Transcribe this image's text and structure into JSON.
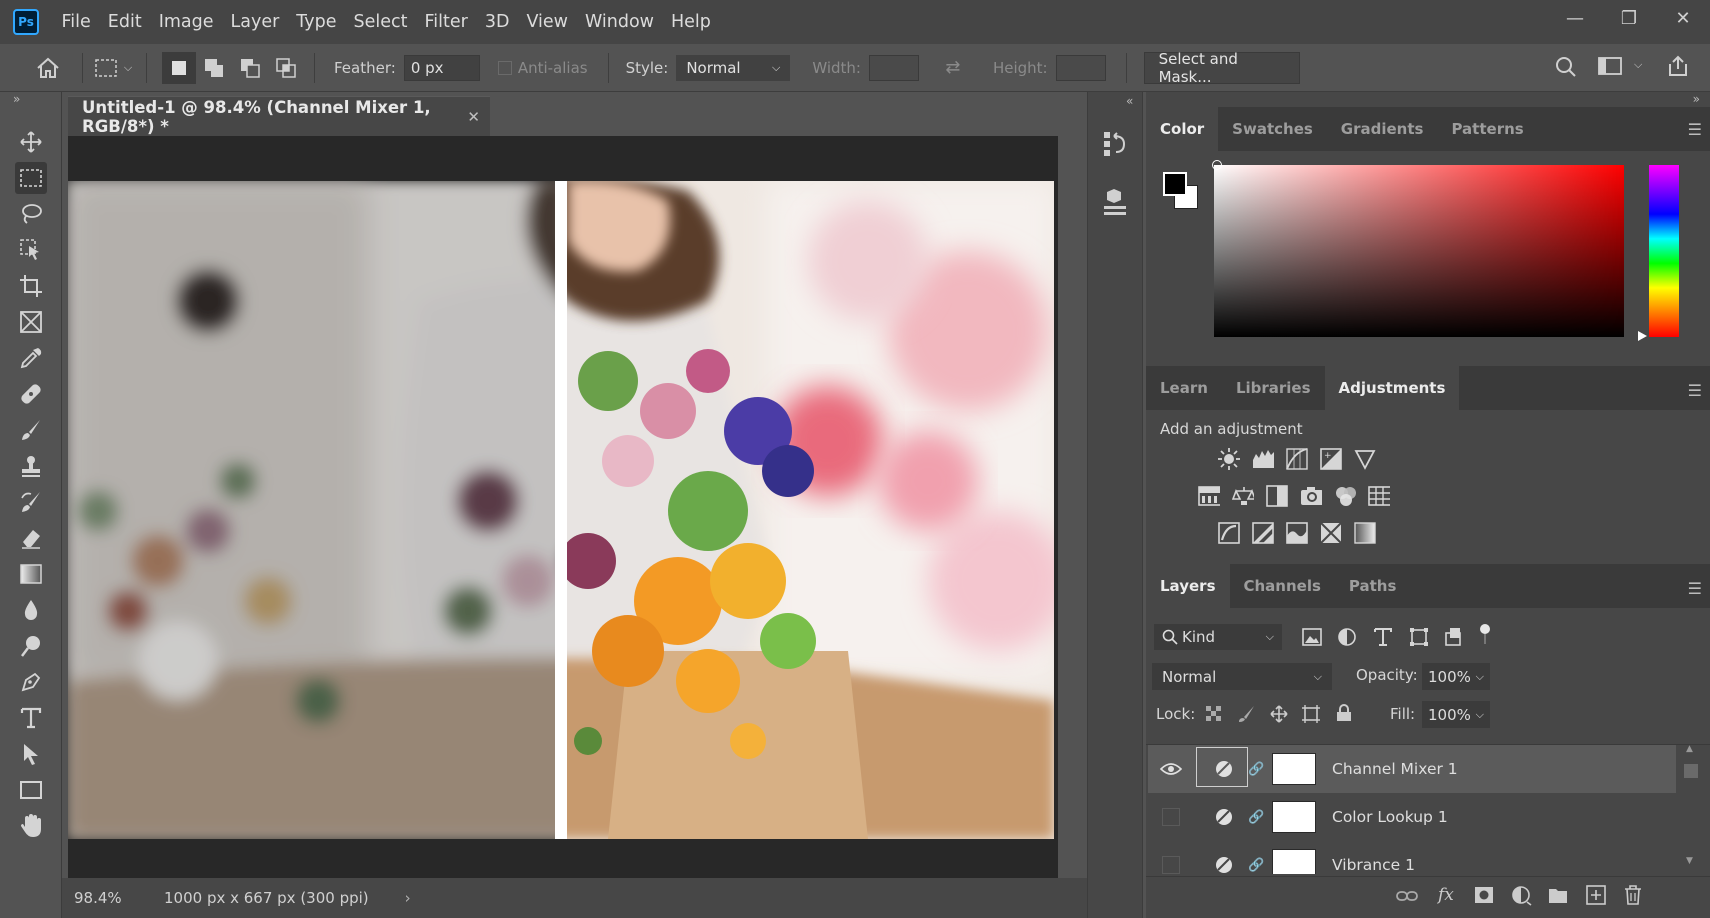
{
  "app": {
    "logo": "Ps"
  },
  "menu": [
    "File",
    "Edit",
    "Image",
    "Layer",
    "Type",
    "Select",
    "Filter",
    "3D",
    "View",
    "Window",
    "Help"
  ],
  "options": {
    "feather_label": "Feather:",
    "feather_value": "0 px",
    "antialias_label": "Anti-alias",
    "style_label": "Style:",
    "style_value": "Normal",
    "width_label": "Width:",
    "height_label": "Height:",
    "select_mask": "Select and Mask..."
  },
  "document": {
    "tab_title": "Untitled-1 @ 98.4% (Channel Mixer 1, RGB/8*) *",
    "zoom": "98.4%",
    "info": "1000 px x 667 px (300 ppi)"
  },
  "color_panel": {
    "tabs": [
      "Color",
      "Swatches",
      "Gradients",
      "Patterns"
    ],
    "active": "Color",
    "foreground": "#000000",
    "background": "#ffffff",
    "hue": "#ff0000"
  },
  "adjust_panel": {
    "tabs": [
      "Learn",
      "Libraries",
      "Adjustments"
    ],
    "active": "Adjustments",
    "heading": "Add an adjustment"
  },
  "layers_panel": {
    "tabs": [
      "Layers",
      "Channels",
      "Paths"
    ],
    "active": "Layers",
    "filter_kind": "Kind",
    "blend_mode": "Normal",
    "opacity_label": "Opacity:",
    "opacity_value": "100%",
    "lock_label": "Lock:",
    "fill_label": "Fill:",
    "fill_value": "100%",
    "layers": [
      {
        "name": "Channel Mixer 1",
        "visible": true,
        "selected": true
      },
      {
        "name": "Color Lookup 1",
        "visible": false,
        "selected": false
      },
      {
        "name": "Vibrance 1",
        "visible": false,
        "selected": false
      }
    ]
  },
  "icons": [
    "home-icon",
    "marquee-icon",
    "move-icon",
    "lasso-icon",
    "crop-icon",
    "eyedropper-icon",
    "brush-icon",
    "eraser-icon",
    "pen-icon",
    "type-icon",
    "hand-icon",
    "search-icon",
    "eye-icon"
  ]
}
